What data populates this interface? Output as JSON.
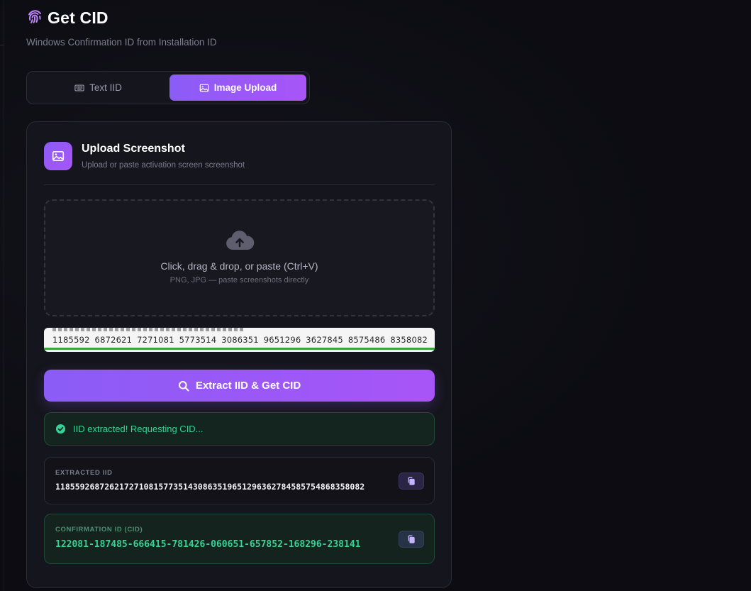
{
  "header": {
    "title": "Get CID",
    "subtitle": "Windows Confirmation ID from Installation ID",
    "icon": "fingerprint-icon"
  },
  "tabs": [
    {
      "label": "Text IID",
      "icon": "keyboard-icon",
      "active": false
    },
    {
      "label": "Image Upload",
      "icon": "image-icon",
      "active": true
    }
  ],
  "card": {
    "title": "Upload Screenshot",
    "subtitle": "Upload or paste activation screen screenshot",
    "icon": "image-icon"
  },
  "dropzone": {
    "icon": "cloud-upload-icon",
    "main_text": "Click, drag & drop, or paste (Ctrl+V)",
    "hint": "PNG, JPG — paste screenshots directly"
  },
  "preview": {
    "groups": [
      "1185592",
      "6872621",
      "7271081",
      "5773514",
      "3086351",
      "9651296",
      "3627845",
      "8575486",
      "8358082"
    ]
  },
  "extract_button": {
    "label": "Extract IID & Get CID",
    "icon": "search-icon"
  },
  "status": {
    "text": "IID extracted! Requesting CID...",
    "icon": "check-circle-icon"
  },
  "extracted_iid": {
    "label": "Extracted IID",
    "value": "118559268726217271081577351430863519651296362784585754868358082"
  },
  "confirmation_id": {
    "label": "Confirmation ID (CID)",
    "value": "122081-187485-666415-781426-060651-657852-168296-238141"
  },
  "colors": {
    "accent": "#8b5cf6",
    "accent_end": "#a855f7",
    "success": "#34d399",
    "background": "#0c0c12",
    "card": "#15151d"
  }
}
